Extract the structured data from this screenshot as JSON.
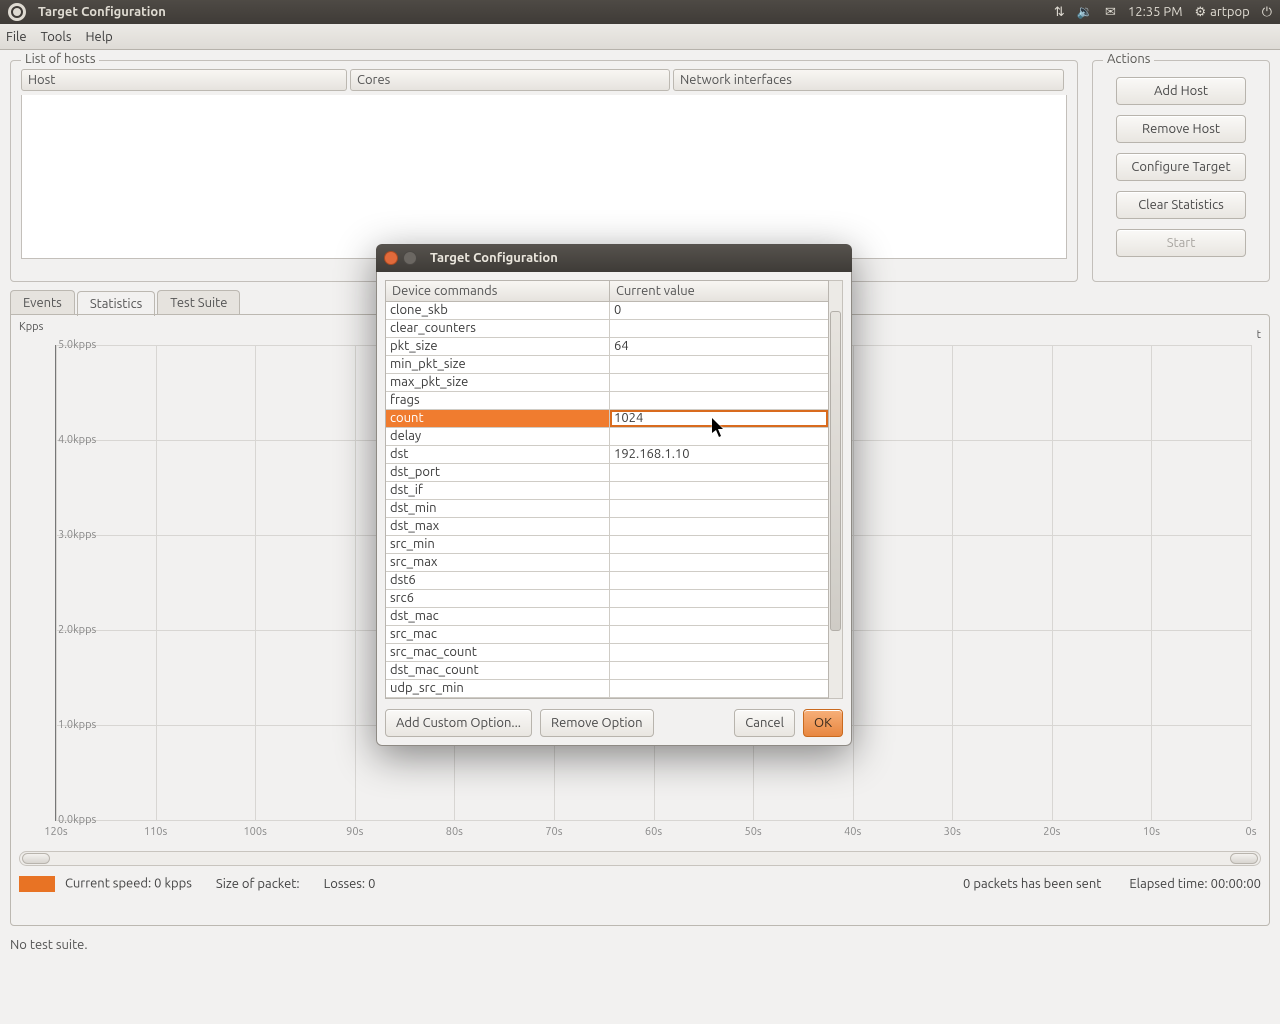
{
  "panel": {
    "title": "Target Configuration",
    "time": "12:35 PM",
    "user": "artpop"
  },
  "menubar": {
    "file": "File",
    "tools": "Tools",
    "help": "Help"
  },
  "hosts_group": {
    "title": "List of hosts",
    "cols": {
      "host": "Host",
      "cores": "Cores",
      "net": "Network interfaces"
    }
  },
  "actions_group": {
    "title": "Actions",
    "add_host": "Add Host",
    "remove_host": "Remove Host",
    "configure": "Configure Target",
    "clear": "Clear Statistics",
    "start": "Start"
  },
  "tabs": {
    "events": "Events",
    "statistics": "Statistics",
    "test_suite": "Test Suite"
  },
  "chart": {
    "y_title": "Kpps",
    "x_title": "t",
    "y_ticks": [
      "5.0kpps",
      "4.0kpps",
      "3.0kpps",
      "2.0kpps",
      "1.0kpps",
      "0.0kpps"
    ],
    "x_ticks": [
      "120s",
      "110s",
      "100s",
      "90s",
      "80s",
      "70s",
      "60s",
      "50s",
      "40s",
      "30s",
      "20s",
      "10s",
      "0s"
    ]
  },
  "status": {
    "speed": "Current speed: 0 kpps",
    "size": "Size of packet:",
    "losses": "Losses: 0",
    "sent": "0 packets has been sent",
    "elapsed": "Elapsed time: 00:00:00"
  },
  "footer": "No test suite.",
  "dialog": {
    "title": "Target Configuration",
    "headers": {
      "cmd": "Device commands",
      "val": "Current value"
    },
    "rows": [
      {
        "cmd": "clone_skb",
        "val": "0"
      },
      {
        "cmd": "clear_counters",
        "val": ""
      },
      {
        "cmd": "pkt_size",
        "val": "64"
      },
      {
        "cmd": "min_pkt_size",
        "val": ""
      },
      {
        "cmd": "max_pkt_size",
        "val": ""
      },
      {
        "cmd": "frags",
        "val": ""
      },
      {
        "cmd": "count",
        "val": "1024"
      },
      {
        "cmd": "delay",
        "val": ""
      },
      {
        "cmd": "dst",
        "val": "192.168.1.10"
      },
      {
        "cmd": "dst_port",
        "val": ""
      },
      {
        "cmd": "dst_if",
        "val": ""
      },
      {
        "cmd": "dst_min",
        "val": ""
      },
      {
        "cmd": "dst_max",
        "val": ""
      },
      {
        "cmd": "src_min",
        "val": ""
      },
      {
        "cmd": "src_max",
        "val": ""
      },
      {
        "cmd": "dst6",
        "val": ""
      },
      {
        "cmd": "src6",
        "val": ""
      },
      {
        "cmd": "dst_mac",
        "val": ""
      },
      {
        "cmd": "src_mac",
        "val": ""
      },
      {
        "cmd": "src_mac_count",
        "val": ""
      },
      {
        "cmd": "dst_mac_count",
        "val": ""
      },
      {
        "cmd": "udp_src_min",
        "val": ""
      }
    ],
    "selected_index": 6,
    "buttons": {
      "add": "Add Custom Option...",
      "remove": "Remove Option",
      "cancel": "Cancel",
      "ok": "OK"
    }
  },
  "chart_data": {
    "type": "line",
    "title": "",
    "xlabel": "t",
    "ylabel": "Kpps",
    "ylim": [
      0,
      5
    ],
    "x": [
      120,
      110,
      100,
      90,
      80,
      70,
      60,
      50,
      40,
      30,
      20,
      10,
      0
    ],
    "series": [
      {
        "name": "Current speed",
        "values": [
          0,
          0,
          0,
          0,
          0,
          0,
          0,
          0,
          0,
          0,
          0,
          0,
          0
        ]
      }
    ]
  }
}
